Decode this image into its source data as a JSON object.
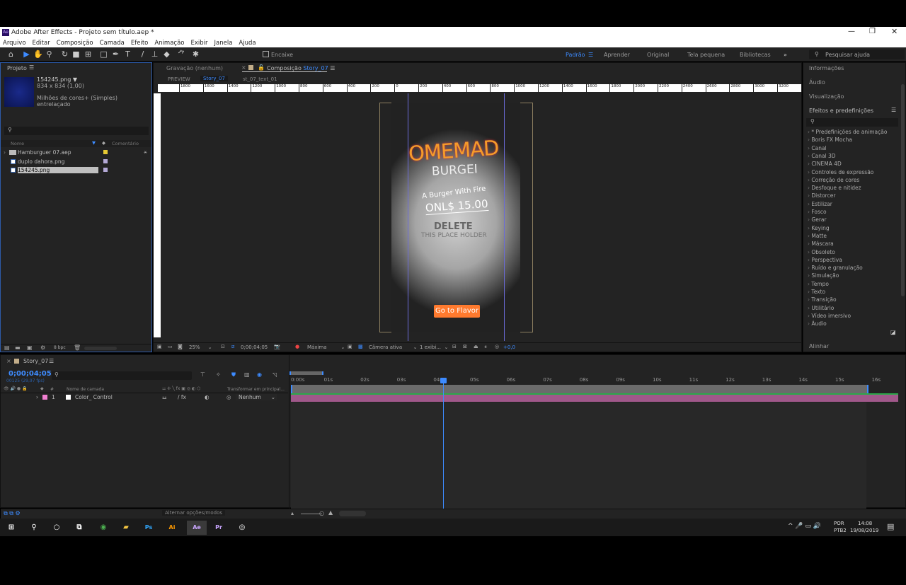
{
  "window": {
    "title": "Adobe After Effects - Projeto sem título.aep *",
    "app_icon": "Ae"
  },
  "menu": [
    "Arquivo",
    "Editar",
    "Composição",
    "Camada",
    "Efeito",
    "Animação",
    "Exibir",
    "Janela",
    "Ajuda"
  ],
  "toolbar": {
    "snap_label": "Encaixe",
    "workspaces": [
      "Padrão",
      "Aprender",
      "Original",
      "Tela pequena",
      "Bibliotecas"
    ],
    "active_workspace": "Padrão",
    "search_placeholder": "Pesquisar ajuda",
    "more": "»"
  },
  "project": {
    "title": "Projeto",
    "selected_name": "154245.png ▼",
    "selected_dims": "834 x 834 (1,00)",
    "selected_color": "Milhões de cores+ (Simples)",
    "selected_field": "entrelaçado",
    "col_name": "Nome",
    "col_comment": "Comentário",
    "items": [
      {
        "name": "Hamburguer 07.aep",
        "type": "folder",
        "label_color": "#e6c933"
      },
      {
        "name": "duplo dahora.png",
        "type": "image",
        "label_color": "#b4a9d6"
      },
      {
        "name": "154245.png",
        "type": "image",
        "label_color": "#b4a9d6"
      }
    ],
    "bpc": "8 bpc"
  },
  "viewer": {
    "tab_recording": "Gravação (nenhum)",
    "tab_comp_prefix": "Composição",
    "tab_comp_name": "Story_07",
    "breadcrumb": [
      "PREVIEW",
      "Story_07",
      "st_07_text_01"
    ],
    "ruler": [
      "1800",
      "1600",
      "1400",
      "1200",
      "1000",
      "800",
      "600",
      "400",
      "200",
      "0",
      "200",
      "400",
      "600",
      "800",
      "1000",
      "1200",
      "1400",
      "1600",
      "1800",
      "2000",
      "2200",
      "2400",
      "2600",
      "2800",
      "3000",
      "3200",
      "3400"
    ],
    "comp": {
      "headline": "OMEMAD",
      "sub": "BURGEI",
      "tagline": "A Burger With Fire",
      "price": "ONL$ 15.00",
      "placeholder1": "DELETE",
      "placeholder2": "THIS PLACE HOLDER",
      "button": "Go to Flavor",
      "accent": "#ff7a2e"
    },
    "footer": {
      "zoom": "25%",
      "timecode": "0;00;04;05",
      "resolution": "Máxima",
      "camera": "Câmera ativa",
      "views": "1 exibi...",
      "exposure": "+0,0"
    }
  },
  "right": {
    "panels": [
      "Informações",
      "Áudio",
      "Visualização"
    ],
    "effects_title": "Efeitos e predefinições",
    "effects": [
      "* Predefinições de animação",
      "Boris FX Mocha",
      "Canal",
      "Canal 3D",
      "CINEMA 4D",
      "Controles de expressão",
      "Correção de cores",
      "Desfoque e nitidez",
      "Distorcer",
      "Estilizar",
      "Fosco",
      "Gerar",
      "Keying",
      "Matte",
      "Máscara",
      "Obsoleto",
      "Perspectiva",
      "Ruído e granulação",
      "Simulação",
      "Tempo",
      "Texto",
      "Transição",
      "Utilitário",
      "Vídeo imersivo",
      "Áudio"
    ],
    "align": "Alinhar"
  },
  "timeline": {
    "comp_tab": "Story_07",
    "timecode": "0;00;04;05",
    "frames": "00125 (29,97 fps)",
    "col_layer_name": "Nome de camada",
    "col_num": "#",
    "col_parent": "Transformar em principal...",
    "layers": [
      {
        "num": "1",
        "name": "Color_ Control",
        "label_color": "#f07fd0",
        "parent": "Nenhum"
      }
    ],
    "seconds": [
      "0:00s",
      "01s",
      "02s",
      "03s",
      "04s",
      "05s",
      "06s",
      "07s",
      "08s",
      "09s",
      "10s",
      "11s",
      "12s",
      "13s",
      "14s",
      "15s",
      "16s"
    ],
    "playhead_seconds": 4.17,
    "duration_seconds": 15.8,
    "toggle_modes": "Alternar opções/modos"
  },
  "taskbar": {
    "apps": [
      "Chrome",
      "Explorer",
      "Ps",
      "Ai",
      "Ae",
      "Pr",
      "OBS"
    ],
    "active": "Ae",
    "lang1": "POR",
    "lang2": "PTB2",
    "time": "14:08",
    "date": "19/08/2019"
  }
}
